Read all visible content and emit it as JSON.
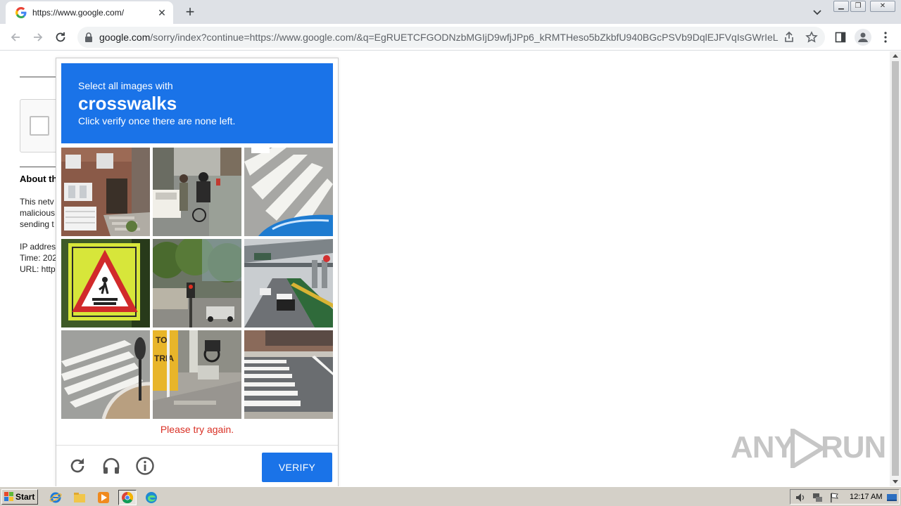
{
  "browser": {
    "tab_title": "https://www.google.com/",
    "url_host": "google.com",
    "url_rest": "/sorry/index?continue=https://www.google.com/&q=EgRUETCFGODNzbMGIjD9wfjJPp6_kRMTHeso5bZkbfU940BGcPSVb9DqlEJFVqIsGWrIeLui..."
  },
  "page": {
    "about_title": "About th",
    "body_line1": "This netv",
    "body_line2": "malicious",
    "body_line3": "sending t",
    "ip_line": "IP addres",
    "time_line": "Time: 202",
    "url_line": "URL: http"
  },
  "captcha": {
    "instruction": "Select all images with",
    "keyword": "crosswalks",
    "sub_instruction": "Click verify once there are none left.",
    "error_message": "Please try again.",
    "verify_label": "VERIFY",
    "header_color": "#1a73e8",
    "tiles": [
      {
        "subject": "brick-house"
      },
      {
        "subject": "street-cyclist"
      },
      {
        "subject": "crosswalk-stripes-car"
      },
      {
        "subject": "pedestrian-crossing-sign"
      },
      {
        "subject": "traffic-light-trees"
      },
      {
        "subject": "highway-overpass"
      },
      {
        "subject": "crosswalk-roundabout"
      },
      {
        "subject": "motorcycle-storefront"
      },
      {
        "subject": "crosswalk-street"
      }
    ]
  },
  "watermark": {
    "left": "ANY",
    "right": "RUN"
  },
  "taskbar": {
    "start_label": "Start",
    "clock": "12:17 AM"
  }
}
